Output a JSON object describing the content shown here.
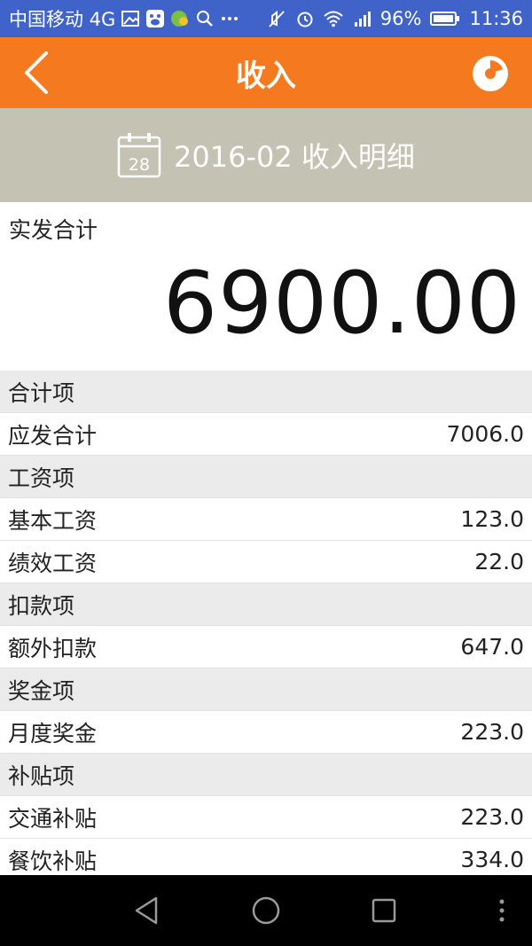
{
  "status_bar": {
    "carrier": "中国移动 4G",
    "battery": "96%",
    "time": "11:36"
  },
  "app_bar": {
    "title": "收入"
  },
  "period": {
    "calendar_day": "28",
    "label": "2016-02 收入明细"
  },
  "total": {
    "label": "实发合计",
    "value": "6900.00"
  },
  "rows": [
    {
      "type": "section",
      "label": "合计项",
      "value": ""
    },
    {
      "type": "item",
      "label": "应发合计",
      "value": "7006.0"
    },
    {
      "type": "section",
      "label": "工资项",
      "value": ""
    },
    {
      "type": "item",
      "label": "基本工资",
      "value": "123.0"
    },
    {
      "type": "item",
      "label": "绩效工资",
      "value": "22.0"
    },
    {
      "type": "section",
      "label": "扣款项",
      "value": ""
    },
    {
      "type": "item",
      "label": "额外扣款",
      "value": "647.0"
    },
    {
      "type": "section",
      "label": "奖金项",
      "value": ""
    },
    {
      "type": "item",
      "label": "月度奖金",
      "value": "223.0"
    },
    {
      "type": "section",
      "label": "补贴项",
      "value": ""
    },
    {
      "type": "item",
      "label": "交通补贴",
      "value": "223.0"
    },
    {
      "type": "item",
      "label": "餐饮补贴",
      "value": "334.0"
    }
  ],
  "colors": {
    "status_bar": "#3f63c9",
    "app_bar": "#f5791f",
    "period_bar": "#c3c2b3",
    "section_bg": "#ebebeb"
  },
  "icons": {
    "back": "chevron-left-icon",
    "chart": "pie-chart-icon",
    "calendar": "calendar-icon",
    "nav_back": "triangle-back-icon",
    "nav_home": "circle-home-icon",
    "nav_recent": "square-recent-icon",
    "nav_menu": "vertical-dots-icon"
  }
}
